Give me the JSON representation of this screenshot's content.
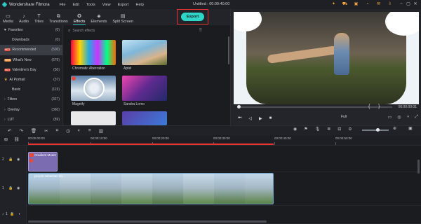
{
  "app": {
    "name": "Wondershare Filmora",
    "menu": [
      "File",
      "Edit",
      "Tools",
      "View",
      "Export",
      "Help"
    ],
    "doc_title": "Untitled : 00:00:40:00",
    "title_icons": [
      "lightbulb-icon",
      "cart-icon",
      "gift-icon",
      "headset-icon",
      "mail-icon",
      "download-icon"
    ]
  },
  "tabs": [
    {
      "label": "Media",
      "icon": "folder-icon"
    },
    {
      "label": "Audio",
      "icon": "music-icon"
    },
    {
      "label": "Titles",
      "icon": "text-icon"
    },
    {
      "label": "Transitions",
      "icon": "transition-icon"
    },
    {
      "label": "Effects",
      "icon": "effects-icon",
      "active": true
    },
    {
      "label": "Elements",
      "icon": "elements-icon"
    },
    {
      "label": "Split Screen",
      "icon": "split-screen-icon"
    }
  ],
  "export_label": "Export",
  "sidebar": {
    "items": [
      {
        "label": "Favorites",
        "count": "(0)",
        "prefix": "heart"
      },
      {
        "label": "Downloads",
        "count": "(0)",
        "prefix": ""
      },
      {
        "label": "Recommended",
        "count": "(500)",
        "prefix": "hot",
        "active": true
      },
      {
        "label": "What's New",
        "count": "(676)",
        "prefix": "new"
      },
      {
        "label": "Valentine's Day",
        "count": "(50)",
        "prefix": "hot"
      },
      {
        "label": "AI Portrait",
        "count": "(37)",
        "prefix": "crown"
      },
      {
        "label": "Basic",
        "count": "(119)",
        "prefix": ""
      },
      {
        "label": "Filters",
        "count": "(327)",
        "prefix": "chevron"
      },
      {
        "label": "Overlay",
        "count": "(360)",
        "prefix": "chevron"
      },
      {
        "label": "LUT",
        "count": "(89)",
        "prefix": "chevron"
      }
    ]
  },
  "library": {
    "search_placeholder": "Search effects",
    "items": [
      {
        "label": "Chromatic Aberration"
      },
      {
        "label": "Aptel"
      },
      {
        "label": "Magnify"
      },
      {
        "label": "Sandra Lomo"
      }
    ]
  },
  "preview": {
    "timecode": "00:00:00:01",
    "mark_in": "{",
    "mark_out": "}",
    "quality": "Full"
  },
  "ruler": {
    "labels": [
      "00:00:00:00",
      "00:00:10:00",
      "00:00:20:00",
      "00:00:30:00",
      "00:00:40:00",
      "00:00:50:00"
    ]
  },
  "tracks": {
    "track2_label": "2",
    "track1_label": "1",
    "audio_label": "1",
    "title_clip": "Gradient Moder",
    "video_clip": "pexels-sebastian-fin..."
  }
}
